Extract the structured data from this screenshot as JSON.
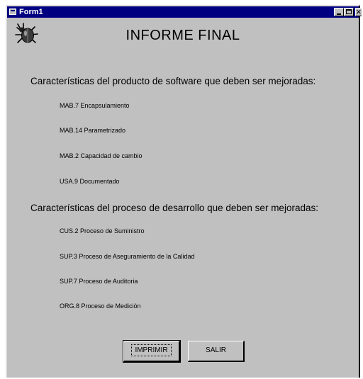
{
  "window": {
    "title": "Form1"
  },
  "header": {
    "title": "INFORME FINAL",
    "logo_icon": "bug-icon"
  },
  "product_section": {
    "heading": "Características del producto de software que deben ser mejoradas:",
    "items": [
      "MAB.7 Encapsulamiento",
      "MAB.14 Parametrizado",
      "MAB.2 Capacidad de cambio",
      "USA.9 Documentado"
    ]
  },
  "process_section": {
    "heading": "Características del proceso de desarrollo que deben ser mejoradas:",
    "items": [
      "CUS.2 Proceso de Suministro",
      "SUP.3 Proceso de Aseguramiento de la Calidad",
      "SUP.7 Proceso de Auditoria",
      "ORG.8 Proceso de Medición"
    ]
  },
  "buttons": {
    "print_label": "IMPRIMIR",
    "exit_label": "SALIR"
  },
  "colors": {
    "titlebar": "#000080",
    "face": "#c0c0c0"
  }
}
